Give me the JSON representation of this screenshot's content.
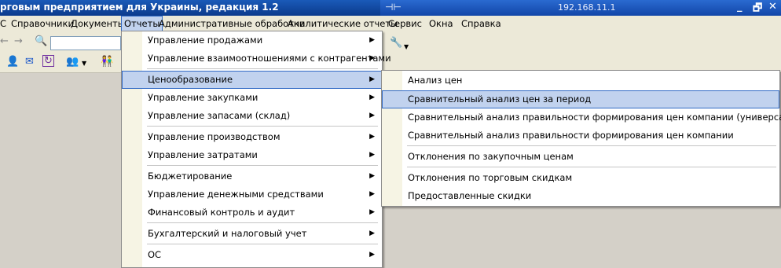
{
  "window": {
    "title": "рговым предприятием для Украины, редакция 1.2",
    "remote_ip": "192.168.11.1",
    "pin_icon": "pin-icon",
    "controls": [
      "_",
      "🗗",
      "✕"
    ]
  },
  "menubar": {
    "items": [
      "С",
      "Справочники",
      "Документы",
      "Отчеты",
      "Административные обработки",
      "Аналитические отчеты",
      "Сервис",
      "Окна",
      "Справка"
    ],
    "active": "Отчеты"
  },
  "reports_menu": {
    "items": [
      {
        "label": "Управление продажами",
        "submenu": true
      },
      {
        "label": "Управление взаимоотношениями с контрагентами",
        "submenu": true
      },
      {
        "label": "Ценообразование",
        "submenu": true,
        "highlighted": true
      },
      {
        "label": "Управление закупками",
        "submenu": true
      },
      {
        "label": "Управление запасами (склад)",
        "submenu": true
      },
      {
        "label": "Управление производством",
        "submenu": true
      },
      {
        "label": "Управление затратами",
        "submenu": true
      },
      {
        "label": "Бюджетирование",
        "submenu": true
      },
      {
        "label": "Управление денежными средствами",
        "submenu": true
      },
      {
        "label": "Финансовый контроль и аудит",
        "submenu": true
      },
      {
        "label": "Бухгалтерский и налоговый учет",
        "submenu": true
      },
      {
        "label": "ОС",
        "submenu": true
      }
    ]
  },
  "pricing_submenu": {
    "items": [
      {
        "label": "Анализ цен"
      },
      {
        "label": "Сравнительный анализ цен за период",
        "highlighted": true
      },
      {
        "label": "Сравнительный анализ правильности формирования цен компании (универсальный)"
      },
      {
        "label": "Сравнительный анализ правильности формирования цен компании"
      },
      {
        "label": "Отклонения по закупочным ценам"
      },
      {
        "label": "Отклонения по торговым скидкам"
      },
      {
        "label": "Предоставленные скидки"
      }
    ]
  },
  "colors": {
    "highlight": "#c1d2ee",
    "highlight_border": "#316ac5",
    "titlebar": "#0b3a8c"
  }
}
